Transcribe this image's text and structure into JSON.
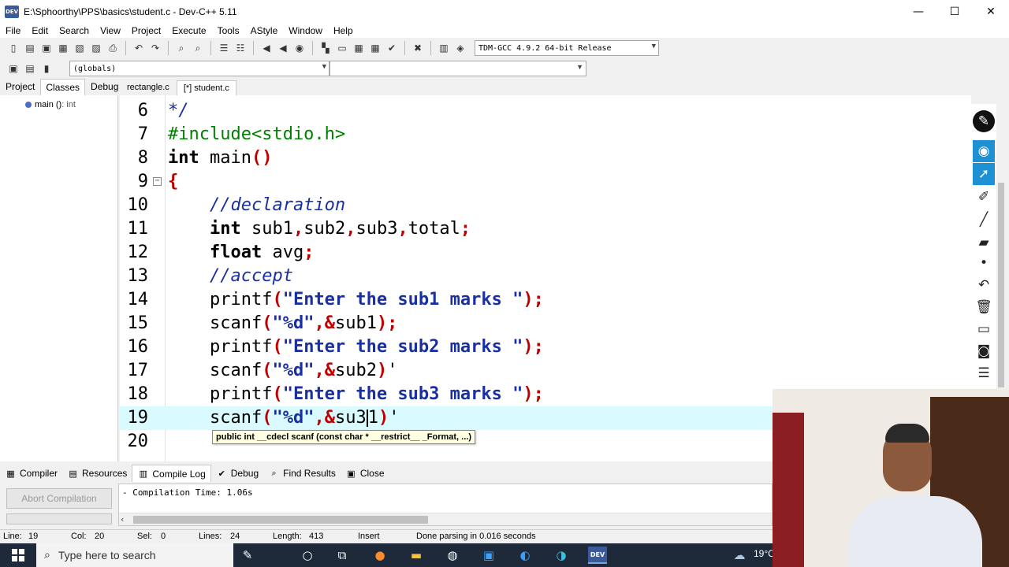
{
  "window": {
    "title": "E:\\Sphoorthy\\PPS\\basics\\student.c - Dev-C++ 5.11",
    "icon_text": "DEV",
    "minimize": "—",
    "maximize": "☐",
    "close": "✕"
  },
  "menu": [
    "File",
    "Edit",
    "Search",
    "View",
    "Project",
    "Execute",
    "Tools",
    "AStyle",
    "Window",
    "Help"
  ],
  "toolbar": {
    "compiler": "TDM-GCC 4.9.2 64-bit Release",
    "scope": "(globals)",
    "function": ""
  },
  "left_panel": {
    "tabs": [
      "Project",
      "Classes",
      "Debug"
    ],
    "active_tab": "Classes",
    "tree": {
      "name": "main ()",
      "type": ": int"
    }
  },
  "editor": {
    "tabs": [
      "rectangle.c",
      "[*] student.c"
    ],
    "active_tab": "[*] student.c",
    "highlight_line": 19,
    "lines": [
      {
        "n": "6",
        "text": "*/"
      },
      {
        "n": "7",
        "text": "#include<stdio.h>"
      },
      {
        "n": "8",
        "text": "int main()"
      },
      {
        "n": "9",
        "text": "{"
      },
      {
        "n": "10",
        "text": "    //declaration"
      },
      {
        "n": "11",
        "text": "    int sub1,sub2,sub3,total;"
      },
      {
        "n": "12",
        "text": "    float avg;"
      },
      {
        "n": "13",
        "text": "    //accept"
      },
      {
        "n": "14",
        "text": "    printf(\"Enter the sub1 marks \");"
      },
      {
        "n": "15",
        "text": "    scanf(\"%d\",&sub1);"
      },
      {
        "n": "16",
        "text": "    printf(\"Enter the sub2 marks \");"
      },
      {
        "n": "17",
        "text": "    scanf(\"%d\",&sub2)'"
      },
      {
        "n": "18",
        "text": "    printf(\"Enter the sub3 marks \");"
      },
      {
        "n": "19",
        "text": "    scanf(\"%d\",&su31)'"
      },
      {
        "n": "20",
        "text": ""
      }
    ],
    "tooltip": "public int __cdecl scanf (const char * __restrict__ _Format, ...)"
  },
  "bottom_panel": {
    "tabs": [
      "Compiler",
      "Resources",
      "Compile Log",
      "Debug",
      "Find Results",
      "Close"
    ],
    "active_tab": "Compile Log",
    "abort_button": "Abort Compilation",
    "log": "- Compilation Time: 1.06s"
  },
  "status": {
    "line_label": "Line:",
    "line": "19",
    "col_label": "Col:",
    "col": "20",
    "sel_label": "Sel:",
    "sel": "0",
    "lines_label": "Lines:",
    "lines": "24",
    "length_label": "Length:",
    "length": "413",
    "mode": "Insert",
    "message": "Done parsing in 0.016 seconds"
  },
  "taskbar": {
    "search_placeholder": "Type here to search",
    "temperature": "19°C"
  },
  "annotation_tools": [
    "pen-icon",
    "eye-icon",
    "cursor-icon",
    "highlighter-icon",
    "line-icon",
    "eraser-icon",
    "dot-icon",
    "undo-icon",
    "trash-icon",
    "whiteboard-icon",
    "camera-icon",
    "notes-icon"
  ],
  "colors": {
    "keyword": "#000000",
    "string": "#1a2fa0",
    "symbol": "#c00000",
    "comment": "#1a2fa0",
    "preprocessor": "#008000",
    "highlight": "#d9fbff"
  }
}
